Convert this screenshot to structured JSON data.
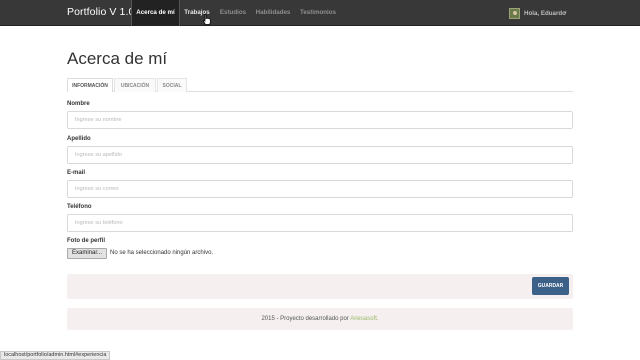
{
  "navbar": {
    "brand": "Portfolio V 1.0.0",
    "items": [
      {
        "label": "Acerca de mí",
        "active": true
      },
      {
        "label": "Trabajos",
        "active": false
      },
      {
        "label": "Estudios",
        "active": false
      },
      {
        "label": "Habilidades",
        "active": false
      },
      {
        "label": "Testimonios",
        "active": false
      }
    ],
    "user": {
      "label": "Hola, Eduardo",
      "caret": "▾"
    }
  },
  "page": {
    "title": "Acerca de mí",
    "tabs": [
      {
        "label": "INFORMACIÓN",
        "active": true
      },
      {
        "label": "UBICACIÓN",
        "active": false
      },
      {
        "label": "SOCIAL",
        "active": false
      }
    ],
    "fields": [
      {
        "label": "Nombre",
        "placeholder": "Ingrese su nombre"
      },
      {
        "label": "Apellido",
        "placeholder": "Ingrese su apellido"
      },
      {
        "label": "E-mail",
        "placeholder": "Ingrese su correo"
      },
      {
        "label": "Teléfono",
        "placeholder": "Ingrese su teléfono"
      }
    ],
    "file": {
      "label": "Foto de perfil",
      "button": "Examinar...",
      "status": "No se ha seleccionado ningún archivo."
    },
    "save_label": "GUARDAR",
    "footer": {
      "text": "2015 - Proyecto desarrollado por ",
      "brand": "Anesasoft."
    }
  },
  "statusbar": "localhost/portfolio/admin.html#experiencia",
  "colors": {
    "navbar": "#383838",
    "primary": "#3c6189",
    "footer_brand": "#9cb86a",
    "panel": "#f5f0ef"
  }
}
